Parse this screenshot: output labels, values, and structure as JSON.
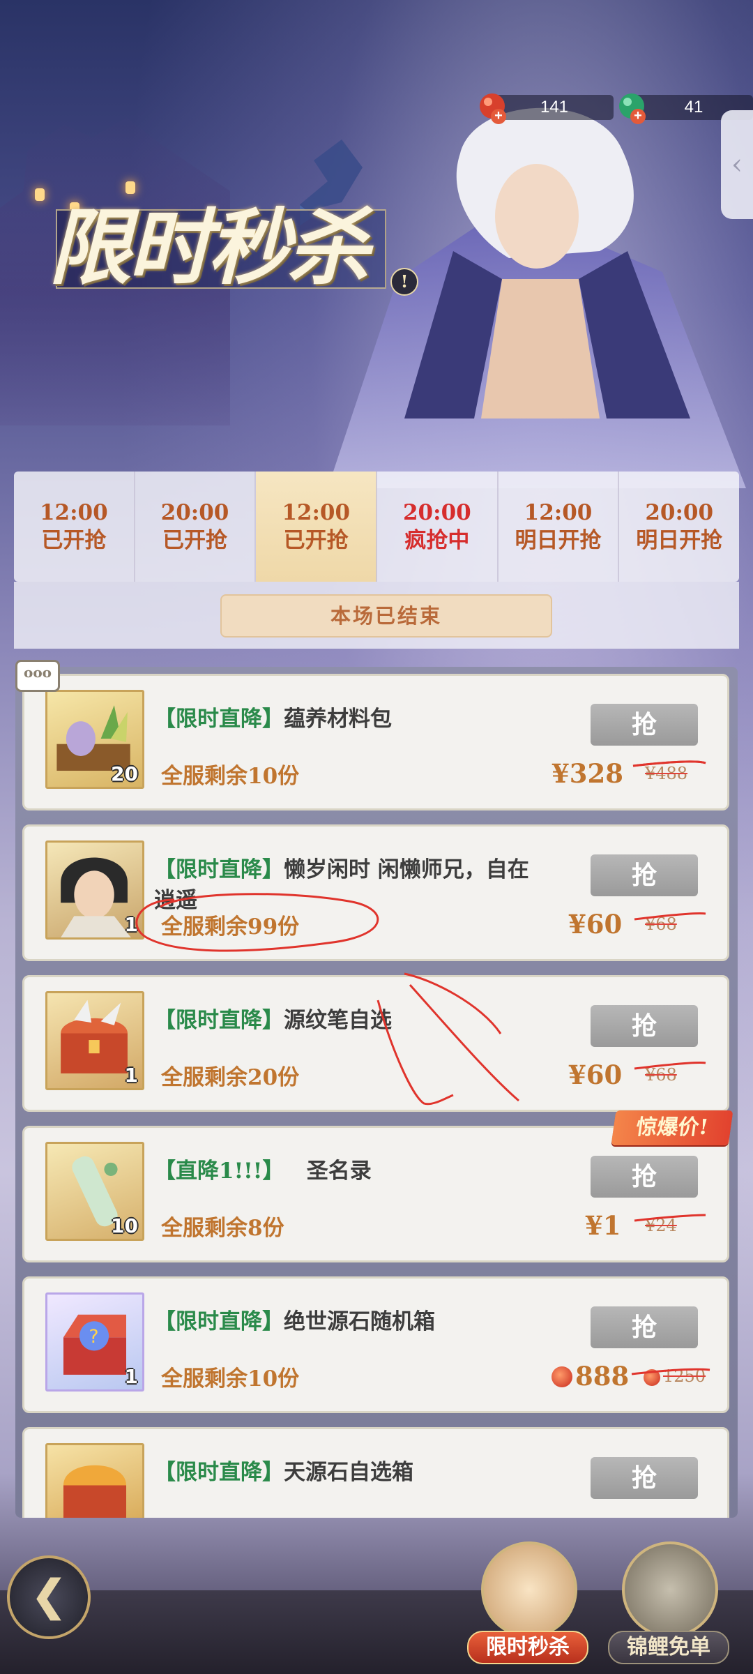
{
  "currency": [
    {
      "value": "141",
      "icon": "red-gem-icon"
    },
    {
      "value": "41",
      "icon": "green-gem-icon"
    }
  ],
  "title": "限时秒杀",
  "slots": [
    {
      "time": "12:00",
      "state": "已开抢"
    },
    {
      "time": "20:00",
      "state": "已开抢"
    },
    {
      "time": "12:00",
      "state": "已开抢"
    },
    {
      "time": "20:00",
      "state": "疯抢中"
    },
    {
      "time": "12:00",
      "state": "明日开抢"
    },
    {
      "time": "20:00",
      "state": "明日开抢"
    }
  ],
  "ended_text": "本场已结束",
  "chat_bubble": "ooo",
  "hot_badge": "惊爆价!",
  "buy_label": "抢",
  "items": [
    {
      "tag": "【限时直降】",
      "name": "蕴养材料包",
      "count": "20",
      "remain": "全服剩余10份",
      "price": "¥328",
      "old_price": "¥488"
    },
    {
      "tag": "【限时直降】",
      "name": "懒岁闲时 闲懒师兄，自在逍遥",
      "count": "1",
      "remain": "全服剩余99份",
      "price": "¥60",
      "old_price": "¥68"
    },
    {
      "tag": "【限时直降】",
      "name": "源纹笔自选",
      "count": "1",
      "remain": "全服剩余20份",
      "price": "¥60",
      "old_price": "¥68"
    },
    {
      "tag": "【直降1!!!】",
      "name": "圣名录",
      "count": "10",
      "remain": "全服剩余8份",
      "price": "¥1",
      "old_price": "¥24"
    },
    {
      "tag": "【限时直降】",
      "name": "绝世源石随机箱",
      "count": "1",
      "remain": "全服剩余10份",
      "price": "888",
      "old_price": "1250"
    },
    {
      "tag": "【限时直降】",
      "name": "天源石自选箱",
      "count": "",
      "remain": "",
      "price": "",
      "old_price": ""
    }
  ],
  "nav": [
    {
      "label": "限时秒杀",
      "active": true
    },
    {
      "label": "锦鲤免单",
      "active": false
    }
  ],
  "colors": {
    "accent": "#c0752f",
    "tag_green": "#2a8a4a",
    "hot_red": "#d62d2d",
    "annotation": "#e0342c"
  }
}
